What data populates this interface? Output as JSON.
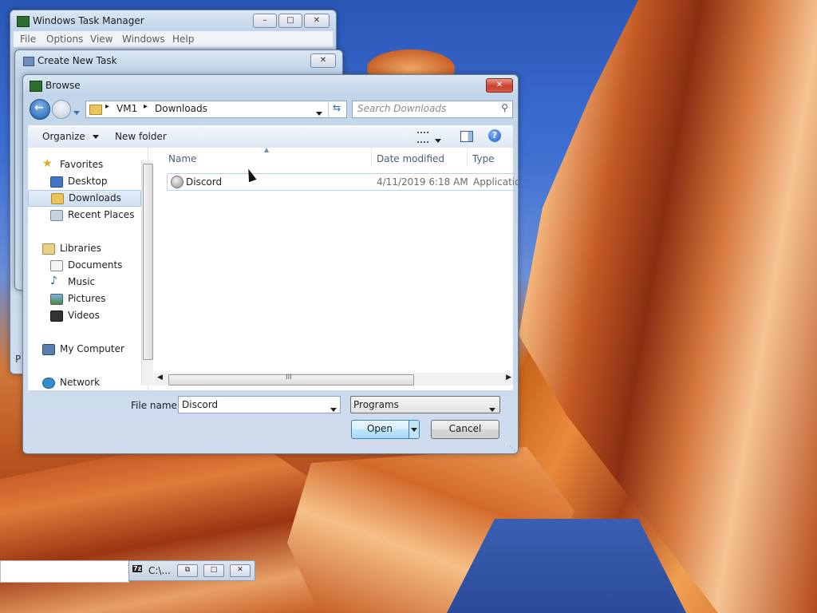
{
  "task_manager": {
    "title": "Windows Task Manager",
    "menu": [
      "File",
      "Options",
      "View",
      "Windows",
      "Help"
    ],
    "partial_letter": "P"
  },
  "create_task": {
    "title": "Create New Task"
  },
  "browse": {
    "title": "Browse",
    "breadcrumb": [
      "VM1",
      "Downloads"
    ],
    "search_placeholder": "Search Downloads",
    "toolbar": {
      "organize": "Organize",
      "new_folder": "New folder"
    },
    "nav": {
      "favorites": "Favorites",
      "desktop": "Desktop",
      "downloads": "Downloads",
      "recent": "Recent Places",
      "libraries": "Libraries",
      "documents": "Documents",
      "music": "Music",
      "pictures": "Pictures",
      "videos": "Videos",
      "computer": "My Computer",
      "network": "Network"
    },
    "columns": {
      "name": "Name",
      "date": "Date modified",
      "type": "Type"
    },
    "files": [
      {
        "name": "Discord",
        "date": "4/11/2019 6:18 AM",
        "type": "Applicatio"
      }
    ],
    "file_name_label": "File name:",
    "file_name_value": "Discord",
    "file_type": "Programs",
    "open_label": "Open",
    "cancel_label": "Cancel",
    "hscroll_grip": "III"
  },
  "taskbar": {
    "cmd_label": "C:\\...",
    "cmd_icon": "7z"
  }
}
